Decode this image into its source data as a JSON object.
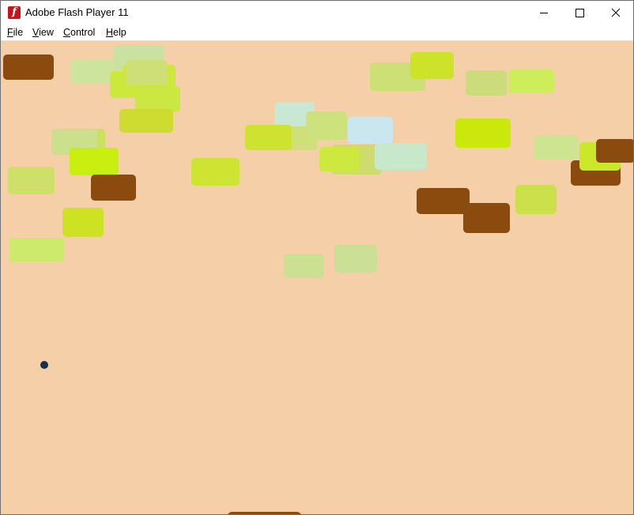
{
  "window": {
    "title": "Adobe Flash Player 11",
    "icon": "flash-player-icon"
  },
  "menu": [
    {
      "key": "F",
      "rest": "ile"
    },
    {
      "key": "V",
      "rest": "iew"
    },
    {
      "key": "C",
      "rest": "ontrol"
    },
    {
      "key": "H",
      "rest": "elp"
    }
  ],
  "colors": {
    "stage_background": "#f5cfa8",
    "brown_brick": "#8b4a0e",
    "ball": "#14334f",
    "paddle": "#8b4a0e"
  },
  "game": {
    "bricks_visible": 39
  }
}
